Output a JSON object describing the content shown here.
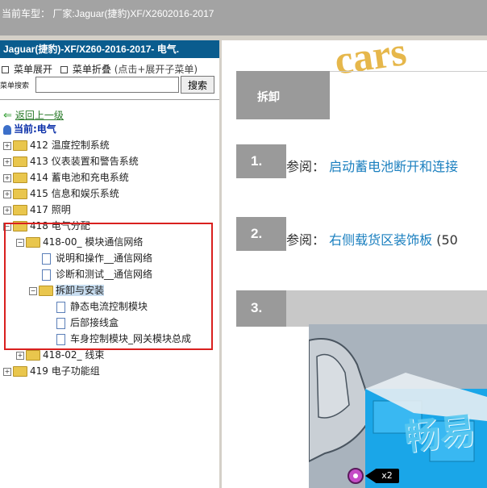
{
  "titlebar": {
    "text": "当前车型： 厂家:Jaguar(捷豹)XF/X2602016-2017"
  },
  "left": {
    "car_title": "Jaguar(捷豹)-XF/X260-2016-2017- 电气.",
    "menu_expand": "菜单展开",
    "menu_collapse": "菜单折叠",
    "menu_hint": "(点击+展开子菜单)",
    "search_label": "菜单搜索",
    "search_value": "",
    "search_button": "搜索",
    "back_label": "返回上一级",
    "current_label": "当前:电气",
    "tree": [
      {
        "label": "412 温度控制系统"
      },
      {
        "label": "413 仪表装置和警告系统"
      },
      {
        "label": "414 蓄电池和充电系统"
      },
      {
        "label": "415 信息和娱乐系统"
      },
      {
        "label": "417 照明"
      },
      {
        "label": "418 电气分配"
      },
      {
        "label": "418-00_ 模块通信网络"
      },
      {
        "label": "说明和操作__通信网络"
      },
      {
        "label": "诊断和测试__通信网络"
      },
      {
        "label": "拆卸与安装"
      },
      {
        "label": "静态电流控制模块"
      },
      {
        "label": "后部接线盒"
      },
      {
        "label": "车身控制模块_网关模块总成"
      },
      {
        "label": "418-02_ 线束"
      },
      {
        "label": "419 电子功能组"
      }
    ]
  },
  "right": {
    "header_label": "拆卸",
    "steps": [
      {
        "num": "1.",
        "prefix": "参阅：",
        "link": "启动蓄电池断开和连接"
      },
      {
        "num": "2.",
        "prefix": "参阅：",
        "link": "右侧载货区装饰板",
        "suffix": "(50"
      },
      {
        "num": "3."
      }
    ],
    "watermark_top": "cars",
    "watermark_img": "畅易",
    "badge": "x2"
  },
  "colors": {
    "title_bg": "#0a5c8e",
    "step_bg": "#9a9a9a",
    "link": "#1a7fbf",
    "highlight_border": "#d9201f"
  }
}
